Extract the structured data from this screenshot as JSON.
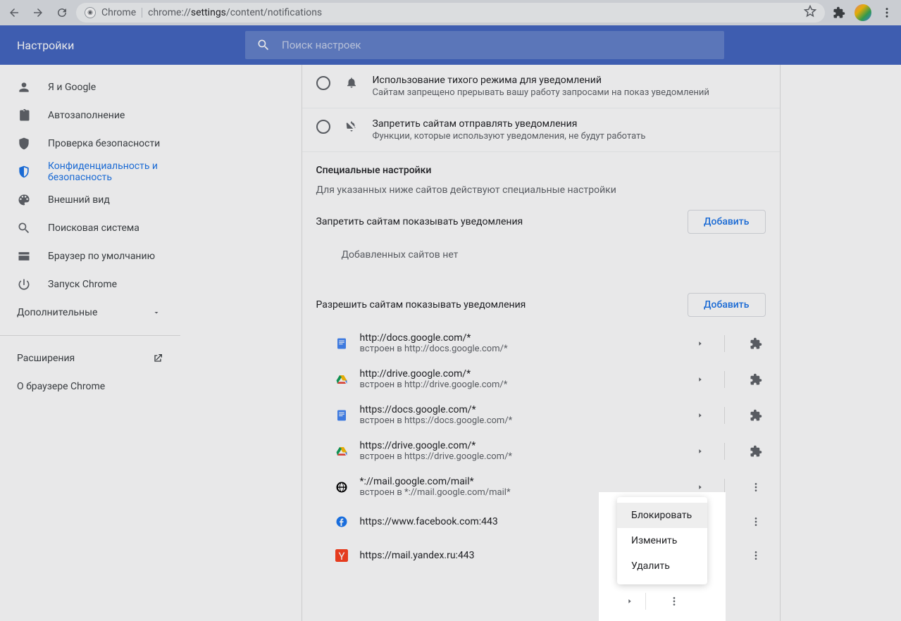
{
  "browser": {
    "url_prefix": "chrome://",
    "url_bold": "settings",
    "url_suffix": "/content/notifications",
    "chrome_label": "Chrome"
  },
  "header": {
    "title": "Настройки",
    "search_placeholder": "Поиск настроек"
  },
  "sidebar": {
    "items": [
      {
        "label": "Я и Google"
      },
      {
        "label": "Автозаполнение"
      },
      {
        "label": "Проверка безопасности"
      },
      {
        "label": "Конфиденциальность и безопасность"
      },
      {
        "label": "Внешний вид"
      },
      {
        "label": "Поисковая система"
      },
      {
        "label": "Браузер по умолчанию"
      },
      {
        "label": "Запуск Chrome"
      }
    ],
    "more": "Дополнительные",
    "extensions": "Расширения",
    "about": "О браузере Chrome"
  },
  "options": [
    {
      "title": "Использование тихого режима для уведомлений",
      "sub": "Сайтам запрещено прерывать вашу работу запросами на показ уведомлений"
    },
    {
      "title": "Запретить сайтам отправлять уведомления",
      "sub": "Функции, которые используют уведомления, не будут работать"
    }
  ],
  "custom": {
    "title": "Специальные настройки",
    "sub": "Для указанных ниже сайтов действуют специальные настройки"
  },
  "block_section": {
    "title": "Запретить сайтам показывать уведомления",
    "add": "Добавить",
    "empty": "Добавленных сайтов нет"
  },
  "allow_section": {
    "title": "Разрешить сайтам показывать уведомления",
    "add": "Добавить"
  },
  "sites": [
    {
      "url": "http://docs.google.com/*",
      "embed": "встроен в http://docs.google.com/*",
      "icon": "docs"
    },
    {
      "url": "http://drive.google.com/*",
      "embed": "встроен в http://drive.google.com/*",
      "icon": "drive"
    },
    {
      "url": "https://docs.google.com/*",
      "embed": "встроен в https://docs.google.com/*",
      "icon": "docs"
    },
    {
      "url": "https://drive.google.com/*",
      "embed": "встроен в https://drive.google.com/*",
      "icon": "drive"
    },
    {
      "url": "*://mail.google.com/mail*",
      "embed": "встроен в *://mail.google.com/mail*",
      "icon": "globe"
    },
    {
      "url": "https://www.facebook.com:443",
      "embed": "",
      "icon": "fb"
    },
    {
      "url": "https://mail.yandex.ru:443",
      "embed": "",
      "icon": "yandex"
    }
  ],
  "menu": {
    "block": "Блокировать",
    "edit": "Изменить",
    "remove": "Удалить"
  }
}
